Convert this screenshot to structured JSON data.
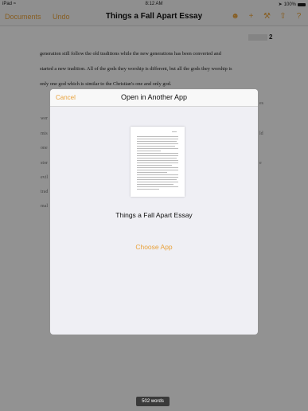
{
  "status": {
    "device": "iPad",
    "wifi_icon": "wifi-icon",
    "time": "8:12 AM",
    "location_icon": "location-arrow-icon",
    "battery": "100%"
  },
  "toolbar": {
    "documents_label": "Documents",
    "undo_label": "Undo",
    "title": "Things a Fall Apart Essay",
    "icons": [
      "people-icon",
      "plus-icon",
      "wrench-icon",
      "share-icon",
      "help-icon"
    ]
  },
  "ruler": {
    "page_number": "2"
  },
  "document": {
    "lines": [
      "generation still follow the old traditions while the new generations has been converted and",
      "started a new tradition. All of the gods they worship is different, but all the gods they worship is",
      "only one god which is similar to the Christian's one and only god."
    ],
    "peek_left": [
      "wer",
      "mis",
      "one",
      "stor",
      "evil",
      "trad",
      "mal"
    ],
    "peek_right": [
      "es",
      "ld",
      "e"
    ]
  },
  "word_count": "502 words",
  "modal": {
    "cancel_label": "Cancel",
    "title": "Open in Another App",
    "document_name": "Things a Fall Apart Essay",
    "choose_label": "Choose App"
  },
  "colors": {
    "accent": "#e9a23b",
    "overlay": "rgba(0,0,0,0.42)"
  }
}
